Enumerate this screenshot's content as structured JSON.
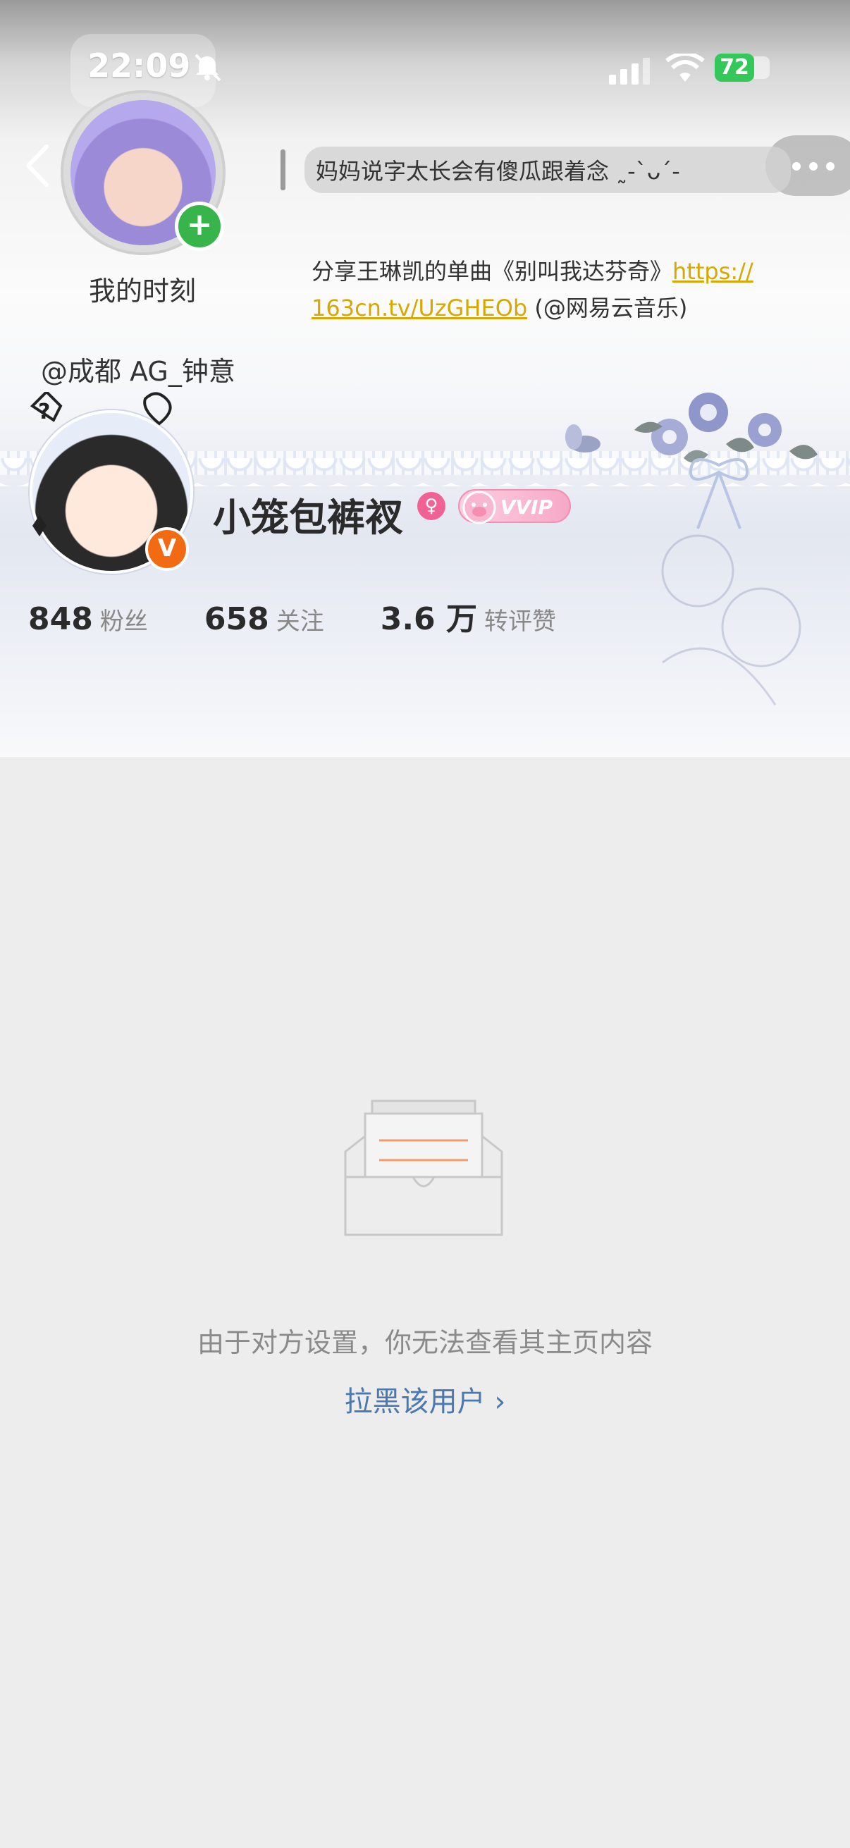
{
  "status_bar": {
    "time": "22:09",
    "battery": "72"
  },
  "moments": {
    "label": "我的时刻"
  },
  "bubble": {
    "text": "妈妈说字太长会有傻瓜跟着念 ˷-ˋᴗˊ-"
  },
  "share": {
    "prefix": "分享王琳凯的单曲《别叫我达芬奇》",
    "link_part1": "https://",
    "link_part2": "163cn.tv/UzGHEOb",
    "suffix": "(@网易云音乐)"
  },
  "mention": "@成都 AG_钟意",
  "profile": {
    "username": "小笼包裤衩",
    "vip_label": "VVIP",
    "verified_mark": "V",
    "gender_icon": "♀"
  },
  "stats": [
    {
      "value": "848",
      "label": "粉丝"
    },
    {
      "value": "658",
      "label": "关注"
    },
    {
      "value": "3.6 万",
      "label": "转评赞"
    }
  ],
  "empty_state": {
    "message": "由于对方设置，你无法查看其主页内容",
    "action": "拉黑该用户 ›"
  },
  "colors": {
    "accent_link": "#4a78b0",
    "verified": "#f26b13",
    "plus_badge": "#38b54a",
    "battery": "#34c759"
  }
}
